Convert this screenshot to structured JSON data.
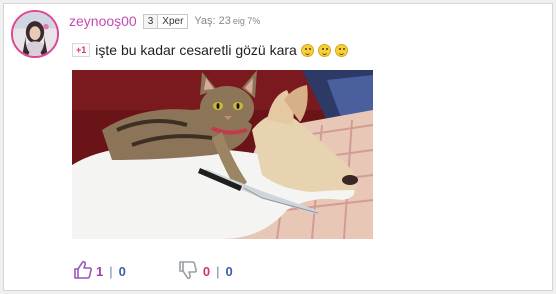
{
  "comment": {
    "username": "zeynooş00",
    "level": "3",
    "rank": "Xper",
    "age": "Yaş: 23",
    "age_ratio": "eig 7%",
    "plus_badge": "+1",
    "text": "işte bu kadar cesaretli gözü kara",
    "emoji_icons": [
      "grin-emoji-icon",
      "grin-emoji-icon",
      "grin-emoji-icon"
    ]
  },
  "votes": {
    "like_count": "1",
    "like_secondary": "0",
    "dislike_count": "0",
    "dislike_secondary": "0",
    "like_icon": "thumbs-up-icon",
    "dislike_icon": "thumbs-down-icon",
    "separator": "|"
  },
  "colors": {
    "username": "#c34bb1",
    "avatar_ring": "#e0478f",
    "like": "#a13bb0",
    "dislike": "#d6336c",
    "count_blue": "#3e5ea8"
  }
}
